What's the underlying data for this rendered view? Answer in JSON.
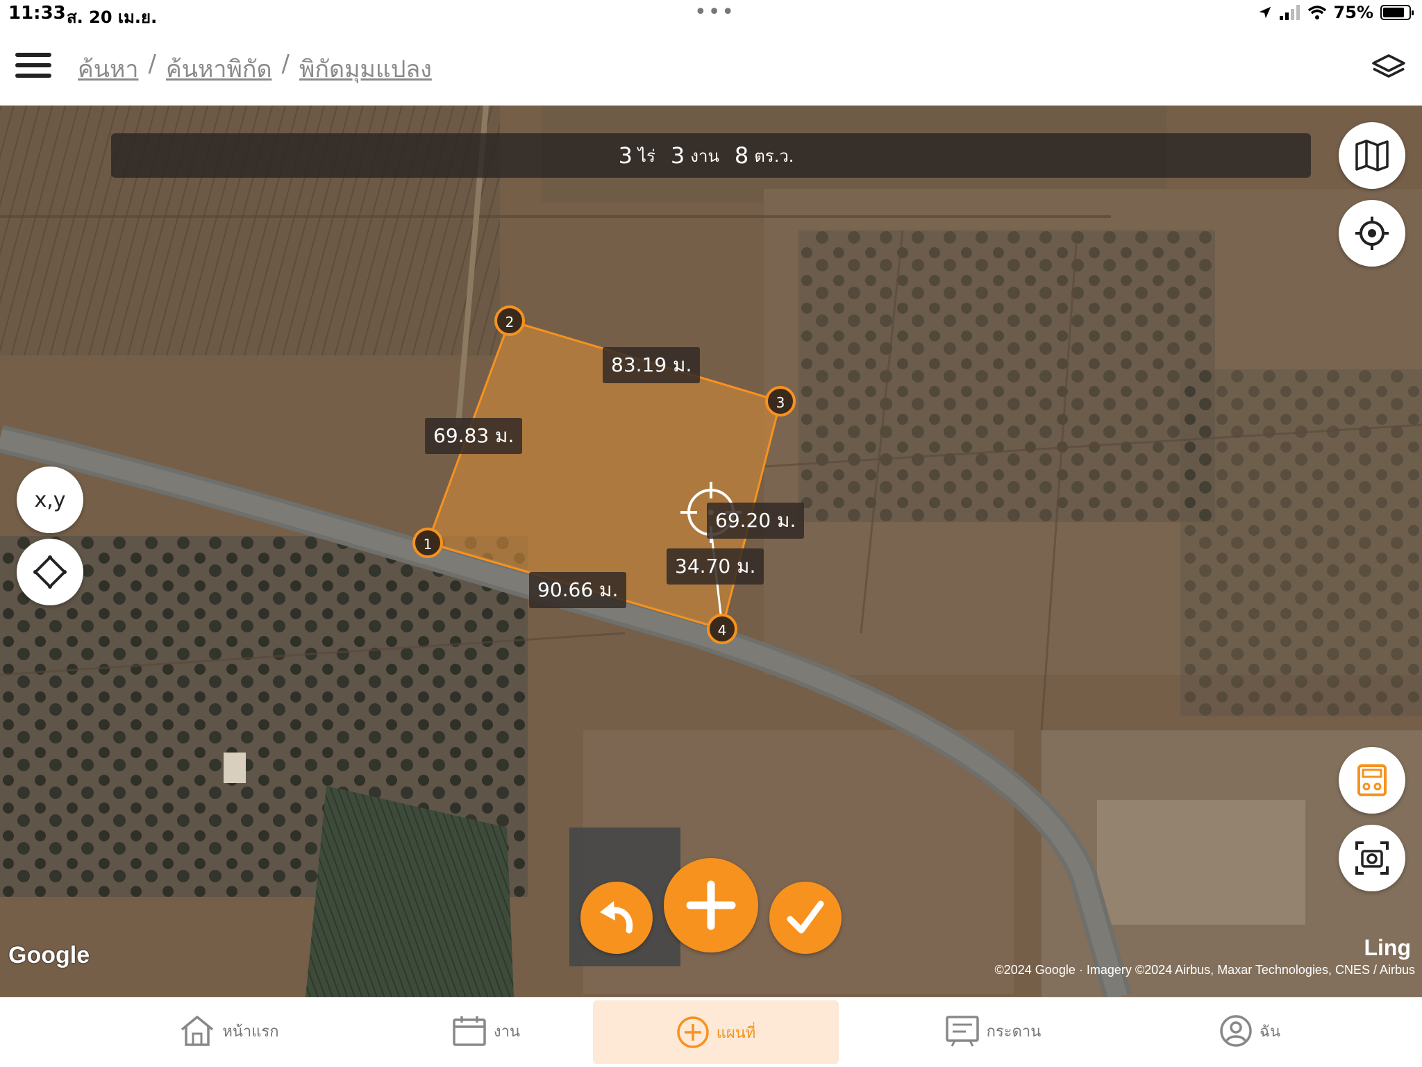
{
  "status_bar": {
    "time": "11:33",
    "date": "ส. 20 เม.ย.",
    "battery": "75%"
  },
  "header": {
    "breadcrumb": [
      "ค้นหา",
      "ค้นหาพิกัด",
      "พิกัดมุมแปลง"
    ],
    "separator": "/"
  },
  "area": {
    "rai": "3",
    "rai_unit": "ไร่",
    "ngan": "3",
    "ngan_unit": "งาน",
    "wa": "8",
    "wa_unit": "ตร.ว."
  },
  "plot": {
    "points": [
      {
        "id": "1"
      },
      {
        "id": "2"
      },
      {
        "id": "3"
      },
      {
        "id": "4"
      }
    ],
    "edges": [
      {
        "label": "83.19 ม."
      },
      {
        "label": "69.83 ม."
      },
      {
        "label": "69.20 ม."
      },
      {
        "label": "34.70 ม."
      },
      {
        "label": "90.66 ม."
      }
    ]
  },
  "left_controls": {
    "xy_label": "x,y"
  },
  "map_attribution": {
    "logo": "Google",
    "brand": "Ling",
    "copyright": "©2024 Google · Imagery ©2024 Airbus, Maxar Technologies, CNES / Airbus"
  },
  "colors": {
    "accent": "#f7921e",
    "plot_fill": "#d1893a"
  },
  "tabs": [
    {
      "label": "หน้าแรก",
      "icon": "home-icon",
      "active": false
    },
    {
      "label": "งาน",
      "icon": "calendar-icon",
      "active": false
    },
    {
      "label": "แผนที่",
      "icon": "plus-circle-icon",
      "active": true
    },
    {
      "label": "กระดาน",
      "icon": "board-icon",
      "active": false
    },
    {
      "label": "ฉัน",
      "icon": "user-icon",
      "active": false
    }
  ]
}
